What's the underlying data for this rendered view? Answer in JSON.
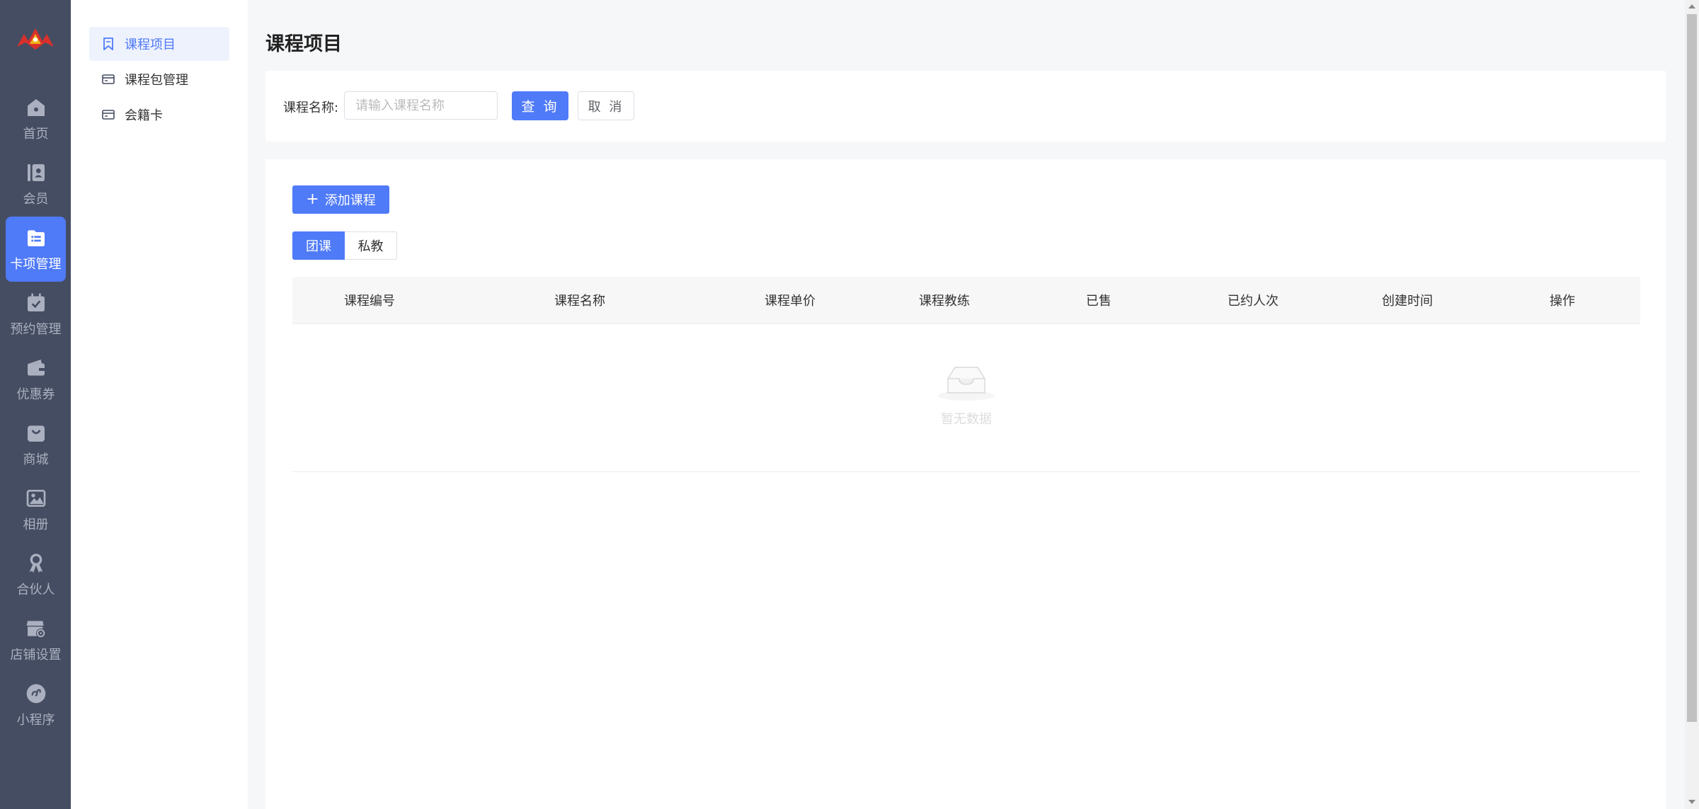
{
  "nav": {
    "items": [
      {
        "label": "首页",
        "icon": "home-icon"
      },
      {
        "label": "会员",
        "icon": "member-icon"
      },
      {
        "label": "卡项管理",
        "icon": "card-folder-icon",
        "active": true
      },
      {
        "label": "预约管理",
        "icon": "calendar-check-icon"
      },
      {
        "label": "优惠券",
        "icon": "wallet-icon"
      },
      {
        "label": "商城",
        "icon": "shopping-bag-icon"
      },
      {
        "label": "相册",
        "icon": "picture-icon"
      },
      {
        "label": "合伙人",
        "icon": "partner-icon"
      },
      {
        "label": "店铺设置",
        "icon": "store-settings-icon"
      },
      {
        "label": "小程序",
        "icon": "mini-program-icon"
      }
    ]
  },
  "subnav": {
    "items": [
      {
        "label": "课程项目",
        "icon": "bookmark-icon",
        "active": true
      },
      {
        "label": "课程包管理",
        "icon": "card-icon"
      },
      {
        "label": "会籍卡",
        "icon": "card-icon"
      }
    ]
  },
  "page": {
    "title": "课程项目"
  },
  "search": {
    "label": "课程名称:",
    "placeholder": "请输入课程名称",
    "value": "",
    "query_label": "查 询",
    "cancel_label": "取 消"
  },
  "toolbar": {
    "add_label": "添加课程"
  },
  "tabs": [
    {
      "label": "团课",
      "active": true
    },
    {
      "label": "私教",
      "active": false
    }
  ],
  "table": {
    "columns": [
      "课程编号",
      "课程名称",
      "课程单价",
      "课程教练",
      "已售",
      "已约人次",
      "创建时间",
      "操作"
    ],
    "rows": [],
    "empty_text": "暂无数据"
  },
  "colors": {
    "accent": "#4f7af8",
    "nav_bg": "#454d62",
    "page_bg": "#f6f7f9"
  }
}
